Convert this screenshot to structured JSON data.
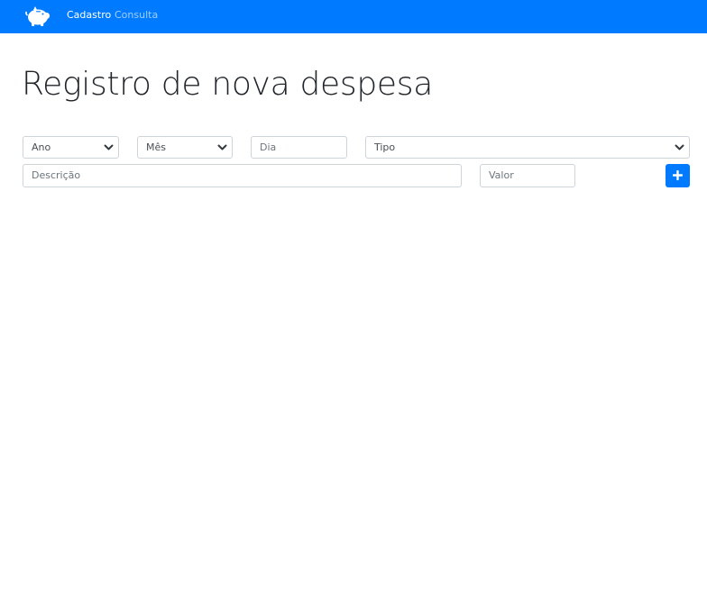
{
  "navbar": {
    "brand_icon": "piggy-bank-icon",
    "links": [
      {
        "label": "Cadastro",
        "active": true
      },
      {
        "label": "Consulta",
        "active": false
      }
    ],
    "background_color": "#007bff"
  },
  "main": {
    "title": "Registro de nova despesa",
    "form": {
      "ano": {
        "selected": "Ano"
      },
      "mes": {
        "selected": "Mês"
      },
      "dia": {
        "placeholder": "Dia",
        "value": ""
      },
      "tipo": {
        "selected": "Tipo"
      },
      "descricao": {
        "placeholder": "Descrição",
        "value": ""
      },
      "valor": {
        "placeholder": "Valor",
        "value": ""
      },
      "add_button_icon": "plus-icon"
    }
  }
}
